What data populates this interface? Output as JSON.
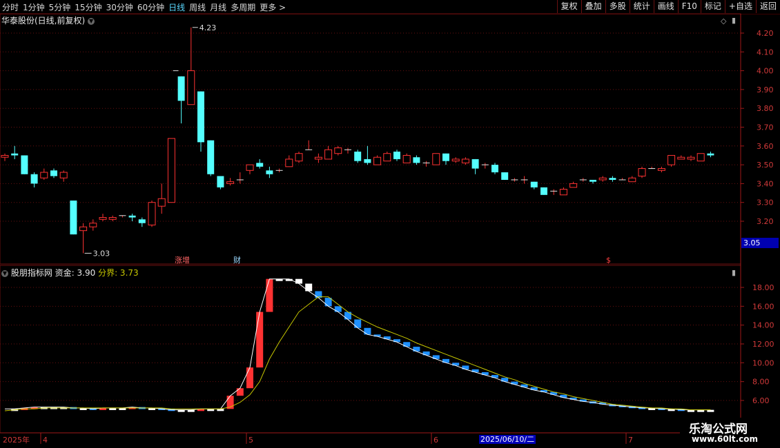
{
  "toolbar": {
    "periods": [
      "分时",
      "1分钟",
      "5分钟",
      "15分钟",
      "30分钟",
      "60分钟",
      "日线",
      "周线",
      "月线",
      "多周期",
      "更多 >"
    ],
    "active_period": "日线",
    "actions": [
      "复权",
      "叠加",
      "多股",
      "统计",
      "画线",
      "F10",
      "标记",
      "+自选",
      "返回"
    ]
  },
  "main_panel": {
    "title": "华泰股份(日线,前复权)",
    "price_axis": [
      "4.20",
      "4.10",
      "4.00",
      "3.90",
      "3.80",
      "3.70",
      "3.60",
      "3.50",
      "3.40",
      "3.30",
      "3.20"
    ],
    "high_label": "4.23",
    "low_label": "3.03",
    "current_price": "3.05",
    "markers": {
      "zhangzeng": "涨增",
      "cai": "财",
      "dollar": "$"
    }
  },
  "indicator_panel": {
    "name": "股朋指标网",
    "fund_label": "资金: 3.90",
    "boundary_label": "分界: 3.73",
    "axis": [
      "18.00",
      "16.00",
      "14.00",
      "12.00",
      "10.00",
      "8.00",
      "6.00"
    ]
  },
  "time_axis": {
    "labels": [
      "2025年",
      "4",
      "5",
      "6",
      "7"
    ],
    "cursor_date": "2025/06/10/二"
  },
  "watermark": {
    "line1": "乐淘公式网",
    "line2": "www.60lt.com"
  },
  "colors": {
    "up": "#ff3232",
    "down": "#54ffff",
    "fund_down": "#1e90ff",
    "boundary": "#c8c800",
    "grid": "#6a1010"
  },
  "chart_data": {
    "type": "candlestick",
    "ylim": [
      3.0,
      4.26
    ],
    "candles": [
      [
        3.54,
        3.56,
        3.52,
        3.55
      ],
      [
        3.56,
        3.6,
        3.53,
        3.55
      ],
      [
        3.55,
        3.55,
        3.45,
        3.45
      ],
      [
        3.45,
        3.46,
        3.38,
        3.4
      ],
      [
        3.43,
        3.48,
        3.42,
        3.46
      ],
      [
        3.47,
        3.48,
        3.43,
        3.44
      ],
      [
        3.43,
        3.47,
        3.41,
        3.46
      ],
      [
        3.31,
        3.31,
        3.13,
        3.13
      ],
      [
        3.15,
        3.19,
        3.03,
        3.17
      ],
      [
        3.17,
        3.21,
        3.15,
        3.19
      ],
      [
        3.21,
        3.24,
        3.2,
        3.22
      ],
      [
        3.21,
        3.23,
        3.2,
        3.22
      ],
      [
        3.23,
        3.23,
        3.22,
        3.23
      ],
      [
        3.23,
        3.24,
        3.2,
        3.22
      ],
      [
        3.21,
        3.22,
        3.17,
        3.19
      ],
      [
        3.18,
        3.31,
        3.17,
        3.3
      ],
      [
        3.28,
        3.4,
        3.24,
        3.32
      ],
      [
        3.3,
        3.64,
        3.3,
        3.64
      ],
      [
        3.97,
        3.97,
        3.72,
        3.84
      ],
      [
        3.82,
        4.23,
        3.82,
        4.0
      ],
      [
        3.89,
        3.89,
        3.57,
        3.62
      ],
      [
        3.63,
        3.63,
        3.44,
        3.45
      ],
      [
        3.44,
        3.44,
        3.37,
        3.38
      ],
      [
        3.4,
        3.43,
        3.39,
        3.41
      ],
      [
        3.42,
        3.46,
        3.4,
        3.42
      ],
      [
        3.47,
        3.5,
        3.45,
        3.5
      ],
      [
        3.51,
        3.53,
        3.48,
        3.49
      ],
      [
        3.47,
        3.49,
        3.43,
        3.45
      ],
      [
        3.47,
        3.48,
        3.46,
        3.47
      ],
      [
        3.49,
        3.55,
        3.49,
        3.53
      ],
      [
        3.52,
        3.57,
        3.51,
        3.56
      ],
      [
        3.58,
        3.63,
        3.58,
        3.58
      ],
      [
        3.53,
        3.56,
        3.51,
        3.54
      ],
      [
        3.53,
        3.6,
        3.53,
        3.58
      ],
      [
        3.56,
        3.6,
        3.55,
        3.59
      ],
      [
        3.58,
        3.59,
        3.56,
        3.58
      ],
      [
        3.57,
        3.58,
        3.51,
        3.52
      ],
      [
        3.53,
        3.6,
        3.5,
        3.51
      ],
      [
        3.5,
        3.55,
        3.5,
        3.54
      ],
      [
        3.52,
        3.57,
        3.52,
        3.56
      ],
      [
        3.57,
        3.58,
        3.52,
        3.53
      ],
      [
        3.51,
        3.56,
        3.51,
        3.55
      ],
      [
        3.54,
        3.55,
        3.5,
        3.51
      ],
      [
        3.51,
        3.52,
        3.49,
        3.51
      ],
      [
        3.5,
        3.56,
        3.5,
        3.56
      ],
      [
        3.56,
        3.56,
        3.5,
        3.52
      ],
      [
        3.52,
        3.54,
        3.51,
        3.53
      ],
      [
        3.51,
        3.54,
        3.5,
        3.53
      ],
      [
        3.53,
        3.53,
        3.45,
        3.48
      ],
      [
        3.5,
        3.51,
        3.48,
        3.5
      ],
      [
        3.5,
        3.51,
        3.45,
        3.46
      ],
      [
        3.46,
        3.46,
        3.42,
        3.42
      ],
      [
        3.42,
        3.43,
        3.41,
        3.42
      ],
      [
        3.42,
        3.44,
        3.4,
        3.42
      ],
      [
        3.41,
        3.41,
        3.37,
        3.38
      ],
      [
        3.38,
        3.38,
        3.34,
        3.34
      ],
      [
        3.36,
        3.37,
        3.34,
        3.36
      ],
      [
        3.34,
        3.38,
        3.34,
        3.37
      ],
      [
        3.38,
        3.41,
        3.38,
        3.4
      ],
      [
        3.42,
        3.43,
        3.41,
        3.42
      ],
      [
        3.42,
        3.42,
        3.4,
        3.41
      ],
      [
        3.42,
        3.44,
        3.41,
        3.43
      ],
      [
        3.43,
        3.44,
        3.41,
        3.42
      ],
      [
        3.42,
        3.43,
        3.42,
        3.42
      ],
      [
        3.41,
        3.44,
        3.41,
        3.43
      ],
      [
        3.44,
        3.49,
        3.43,
        3.48
      ],
      [
        3.48,
        3.49,
        3.48,
        3.48
      ],
      [
        3.47,
        3.49,
        3.46,
        3.48
      ],
      [
        3.5,
        3.55,
        3.49,
        3.55
      ],
      [
        3.53,
        3.55,
        3.53,
        3.54
      ],
      [
        3.53,
        3.55,
        3.52,
        3.54
      ],
      [
        3.52,
        3.56,
        3.52,
        3.56
      ],
      [
        3.56,
        3.57,
        3.54,
        3.55
      ]
    ],
    "indicator": {
      "ylim": [
        4.6,
        19.2
      ],
      "fund": [
        5.1,
        5.1,
        5.2,
        5.3,
        5.3,
        5.3,
        5.3,
        5.2,
        5.2,
        5.1,
        5.2,
        5.2,
        5.2,
        5.3,
        5.2,
        5.2,
        5.1,
        5.0,
        5.0,
        5.0,
        5.1,
        5.1,
        5.1,
        6.5,
        7.3,
        9.5,
        15.4,
        18.9,
        18.9,
        18.9,
        18.4,
        17.6,
        16.9,
        16.0,
        15.4,
        14.6,
        13.7,
        13.0,
        12.8,
        12.5,
        12.2,
        11.7,
        11.2,
        10.8,
        10.4,
        10.0,
        9.7,
        9.3,
        9.0,
        8.7,
        8.4,
        8.0,
        7.7,
        7.4,
        7.1,
        6.9,
        6.6,
        6.3,
        6.1,
        5.9,
        5.8,
        5.6,
        5.5,
        5.4,
        5.3,
        5.2,
        5.2,
        5.1,
        5.1,
        5.0,
        5.0,
        5.0,
        5.0
      ],
      "boundary": [
        4.9,
        5.0,
        5.1,
        5.1,
        5.2,
        5.2,
        5.2,
        5.2,
        5.2,
        5.2,
        5.2,
        5.2,
        5.2,
        5.2,
        5.2,
        5.2,
        5.2,
        5.1,
        5.1,
        5.1,
        5.1,
        5.1,
        5.1,
        5.3,
        5.8,
        6.6,
        8.0,
        10.4,
        12.2,
        13.8,
        15.4,
        16.2,
        17.0,
        17.0,
        16.2,
        15.4,
        14.8,
        14.3,
        13.8,
        13.4,
        13.0,
        12.6,
        12.1,
        11.7,
        11.3,
        10.9,
        10.5,
        10.1,
        9.7,
        9.3,
        8.9,
        8.5,
        8.2,
        7.8,
        7.5,
        7.2,
        6.9,
        6.7,
        6.4,
        6.2,
        6.0,
        5.8,
        5.6,
        5.5,
        5.4,
        5.3,
        5.2,
        5.2,
        5.1,
        5.1,
        5.0,
        5.0,
        5.0
      ]
    }
  }
}
